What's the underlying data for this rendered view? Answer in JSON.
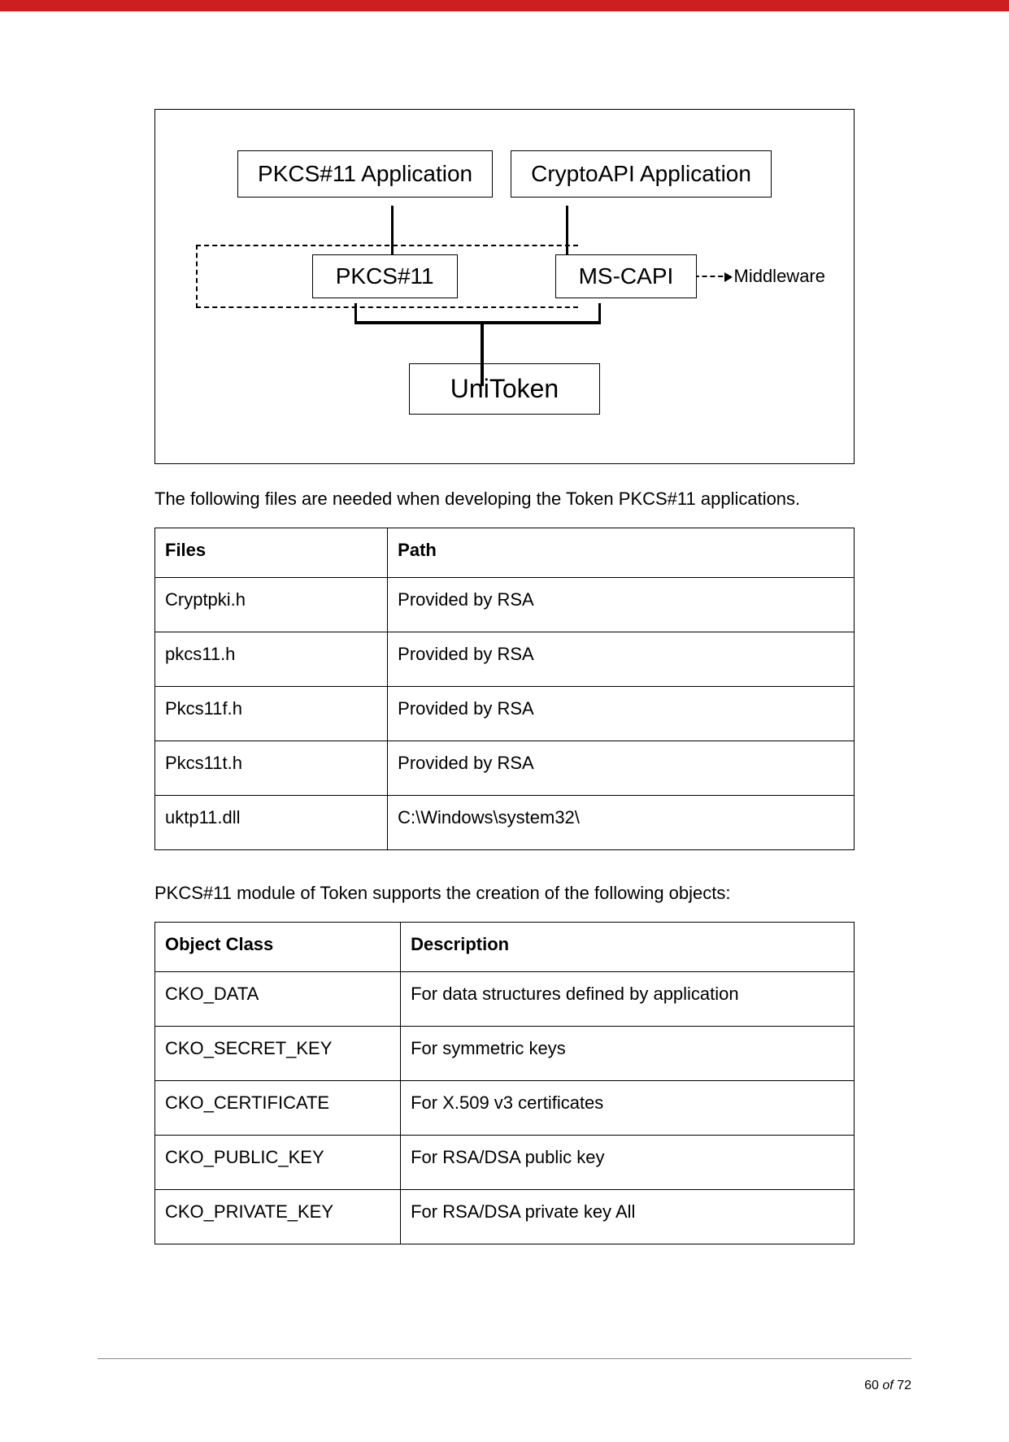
{
  "diagram": {
    "pkcs_app": "PKCS#11 Application",
    "capi_app": "CryptoAPI Application",
    "pkcs11": "PKCS#11",
    "mscapi": "MS-CAPI",
    "middleware": "Middleware",
    "unitoken": "UniToken"
  },
  "para1": "The following files are needed when developing the Token PKCS#11 applications.",
  "table1": {
    "headers": {
      "c1": "Files",
      "c2": "Path"
    },
    "rows": [
      {
        "c1": "Cryptpki.h",
        "c2": "Provided by RSA"
      },
      {
        "c1": "pkcs11.h",
        "c2": "Provided by RSA"
      },
      {
        "c1": "Pkcs11f.h",
        "c2": "Provided by RSA"
      },
      {
        "c1": "Pkcs11t.h",
        "c2": "Provided by RSA"
      },
      {
        "c1": "uktp11.dll",
        "c2": "C:\\Windows\\system32\\"
      }
    ]
  },
  "para2": "PKCS#11 module of Token supports the creation of the following objects:",
  "table2": {
    "headers": {
      "c1": "Object Class",
      "c2": "Description"
    },
    "rows": [
      {
        "c1": "CKO_DATA",
        "c2": "For data structures defined by application"
      },
      {
        "c1": "CKO_SECRET_KEY",
        "c2": "For symmetric keys"
      },
      {
        "c1": "CKO_CERTIFICATE",
        "c2": "For X.509 v3 certificates"
      },
      {
        "c1": "CKO_PUBLIC_KEY",
        "c2": "For RSA/DSA public key"
      },
      {
        "c1": "CKO_PRIVATE_KEY",
        "c2": "For RSA/DSA private key All"
      }
    ]
  },
  "footer": {
    "page": "60",
    "of": "of",
    "total": "72"
  }
}
